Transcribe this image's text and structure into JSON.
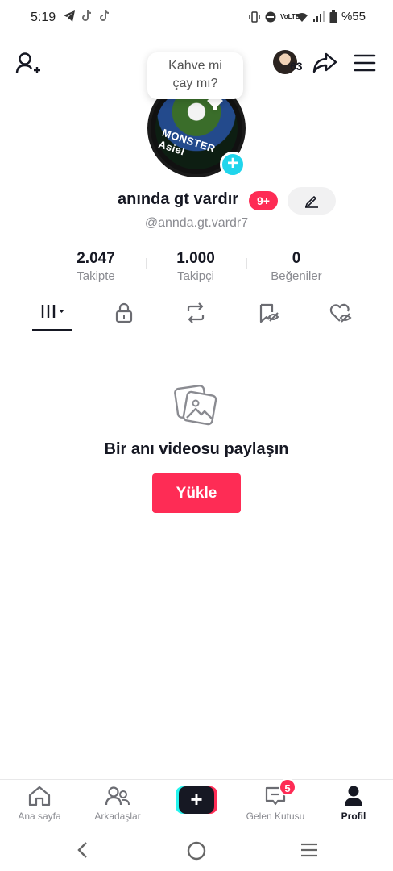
{
  "status_bar": {
    "time": "5:19",
    "battery": "%55",
    "network": "VoLTE",
    "icons": [
      "telegram-icon",
      "tiktok-icon",
      "tiktok-icon",
      "vibrate-icon",
      "dnd-icon",
      "wifi-icon",
      "signal-icon",
      "battery-icon"
    ]
  },
  "header": {
    "top_avatar_count": "63",
    "icons": [
      "add-friend-icon",
      "share-icon",
      "menu-icon"
    ]
  },
  "bubble": {
    "line1": "Kahve mi",
    "line2": "çay mı?"
  },
  "profile": {
    "avatar_text": "MONSTER Asiel",
    "name": "anında gt vardır",
    "badge": "9+",
    "handle": "@annda.gt.vardr7"
  },
  "stats": [
    {
      "value": "2.047",
      "label": "Takipte"
    },
    {
      "value": "1.000",
      "label": "Takipçi"
    },
    {
      "value": "0",
      "label": "Beğeniler"
    }
  ],
  "tabs": [
    {
      "icon": "videos-grid-icon",
      "active": true
    },
    {
      "icon": "lock-icon",
      "active": false
    },
    {
      "icon": "repost-icon",
      "active": false
    },
    {
      "icon": "bookmark-eye-icon",
      "active": false
    },
    {
      "icon": "liked-heart-icon",
      "active": false
    }
  ],
  "empty_state": {
    "title": "Bir anı videosu paylaşın",
    "button": "Yükle"
  },
  "bottom_nav": [
    {
      "label": "Ana sayfa",
      "icon": "home-icon",
      "active": false
    },
    {
      "label": "Arkadaşlar",
      "icon": "friends-icon",
      "active": false
    },
    {
      "label": "",
      "icon": "create-icon",
      "active": false
    },
    {
      "label": "Gelen Kutusu",
      "icon": "inbox-icon",
      "active": false,
      "badge": "5"
    },
    {
      "label": "Profil",
      "icon": "profile-icon",
      "active": true
    }
  ],
  "colors": {
    "accent": "#fe2c55",
    "cyan": "#25f4ee",
    "text": "#161823",
    "muted": "#8a8b91"
  }
}
